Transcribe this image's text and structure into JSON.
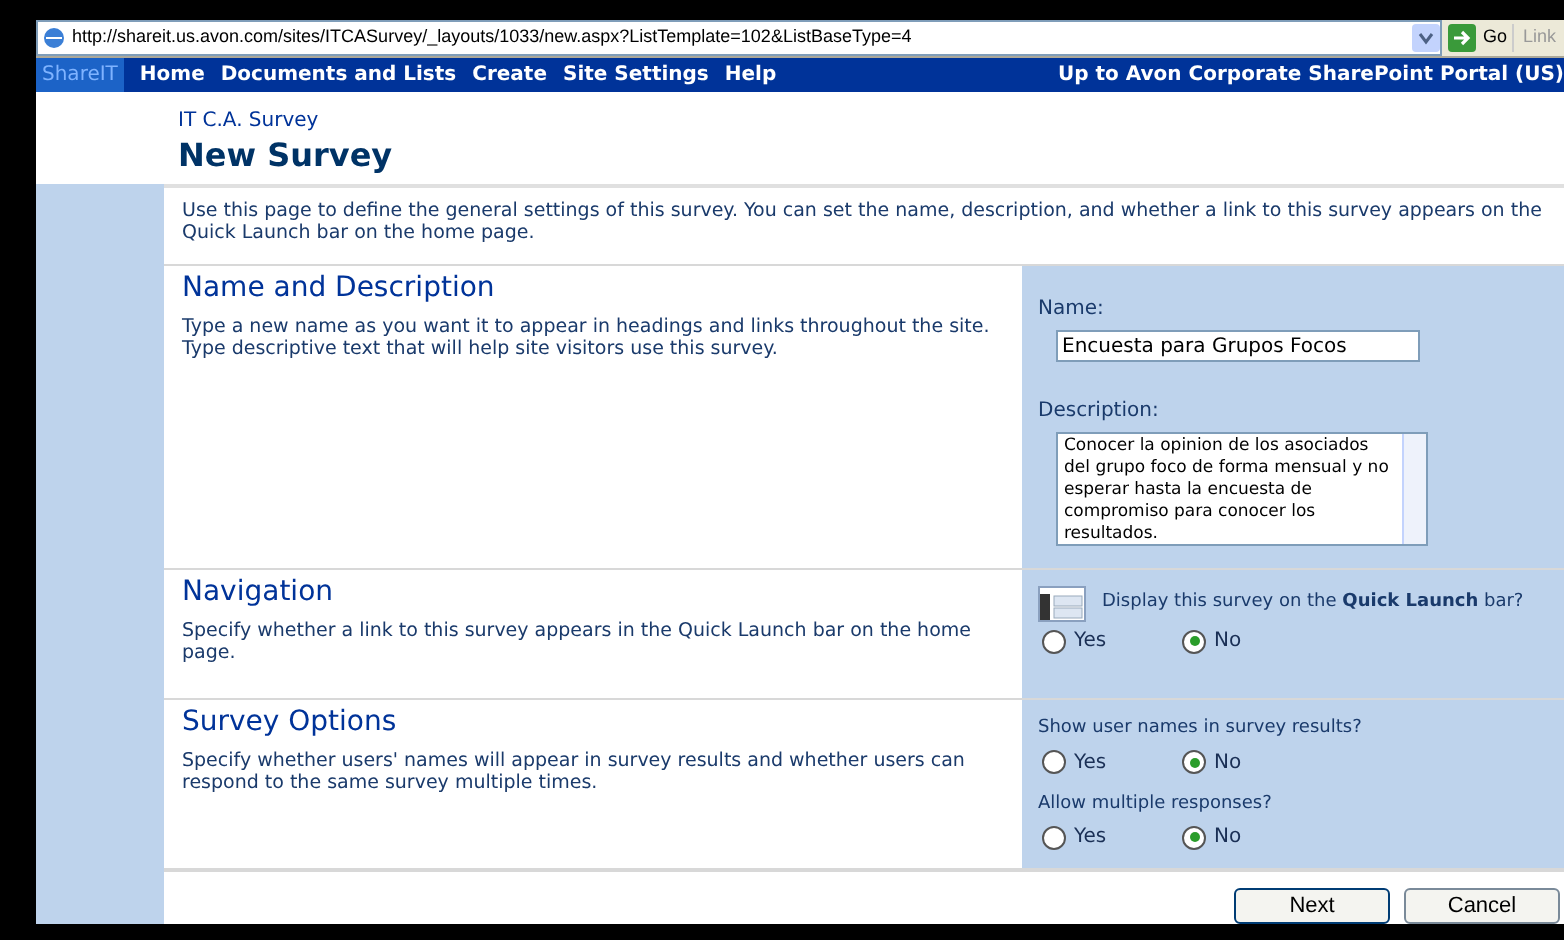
{
  "address_bar": {
    "url": "http://shareit.us.avon.com/sites/ITCASurvey/_layouts/1033/new.aspx?ListTemplate=102&ListBaseType=4",
    "go_label": "Go",
    "links_label": "Link"
  },
  "nav": {
    "logo": "ShareIT",
    "items": [
      "Home",
      "Documents and Lists",
      "Create",
      "Site Settings",
      "Help"
    ],
    "portal_link": "Up to Avon Corporate SharePoint Portal (US)"
  },
  "header": {
    "site": "IT C.A. Survey",
    "title": "New Survey"
  },
  "intro": "Use this page to define the general settings of this survey. You can set the name, description, and whether a link to this survey appears on the Quick Launch bar on the home page.",
  "sections": [
    {
      "kind": "name",
      "title": "Name and Description",
      "description": "Type a new name as you want it to appear in headings and links throughout the site. Type descriptive text that will help site visitors use this survey.",
      "name_label": "Name:",
      "name_value": "Encuesta para Grupos Focos",
      "description_label": "Description:",
      "description_value": "Conocer la opinion de los asociados del grupo foco de forma mensual y no esperar hasta la encuesta de compromiso para conocer los resultados."
    },
    {
      "kind": "options",
      "title": "Navigation",
      "description": "Specify whether a link to this survey appears in the Quick Launch bar on the home page.",
      "questions": [
        {
          "label": "Display this survey on the **Quick Launch** bar?",
          "icon": true,
          "options": [
            {
              "label": "Yes",
              "selected": false
            },
            {
              "label": "No",
              "selected": true
            }
          ]
        }
      ]
    },
    {
      "kind": "options",
      "title": "Survey Options",
      "description": "Specify whether users' names will appear in survey results and whether users can respond to the same survey multiple times.",
      "questions": [
        {
          "label": "Show user names in survey results?",
          "icon": false,
          "options": [
            {
              "label": "Yes",
              "selected": false
            },
            {
              "label": "No",
              "selected": true
            }
          ]
        },
        {
          "label": "Allow multiple responses?",
          "icon": false,
          "options": [
            {
              "label": "Yes",
              "selected": false
            },
            {
              "label": "No",
              "selected": true
            }
          ]
        }
      ]
    }
  ],
  "buttons": [
    "Next",
    "Cancel"
  ]
}
